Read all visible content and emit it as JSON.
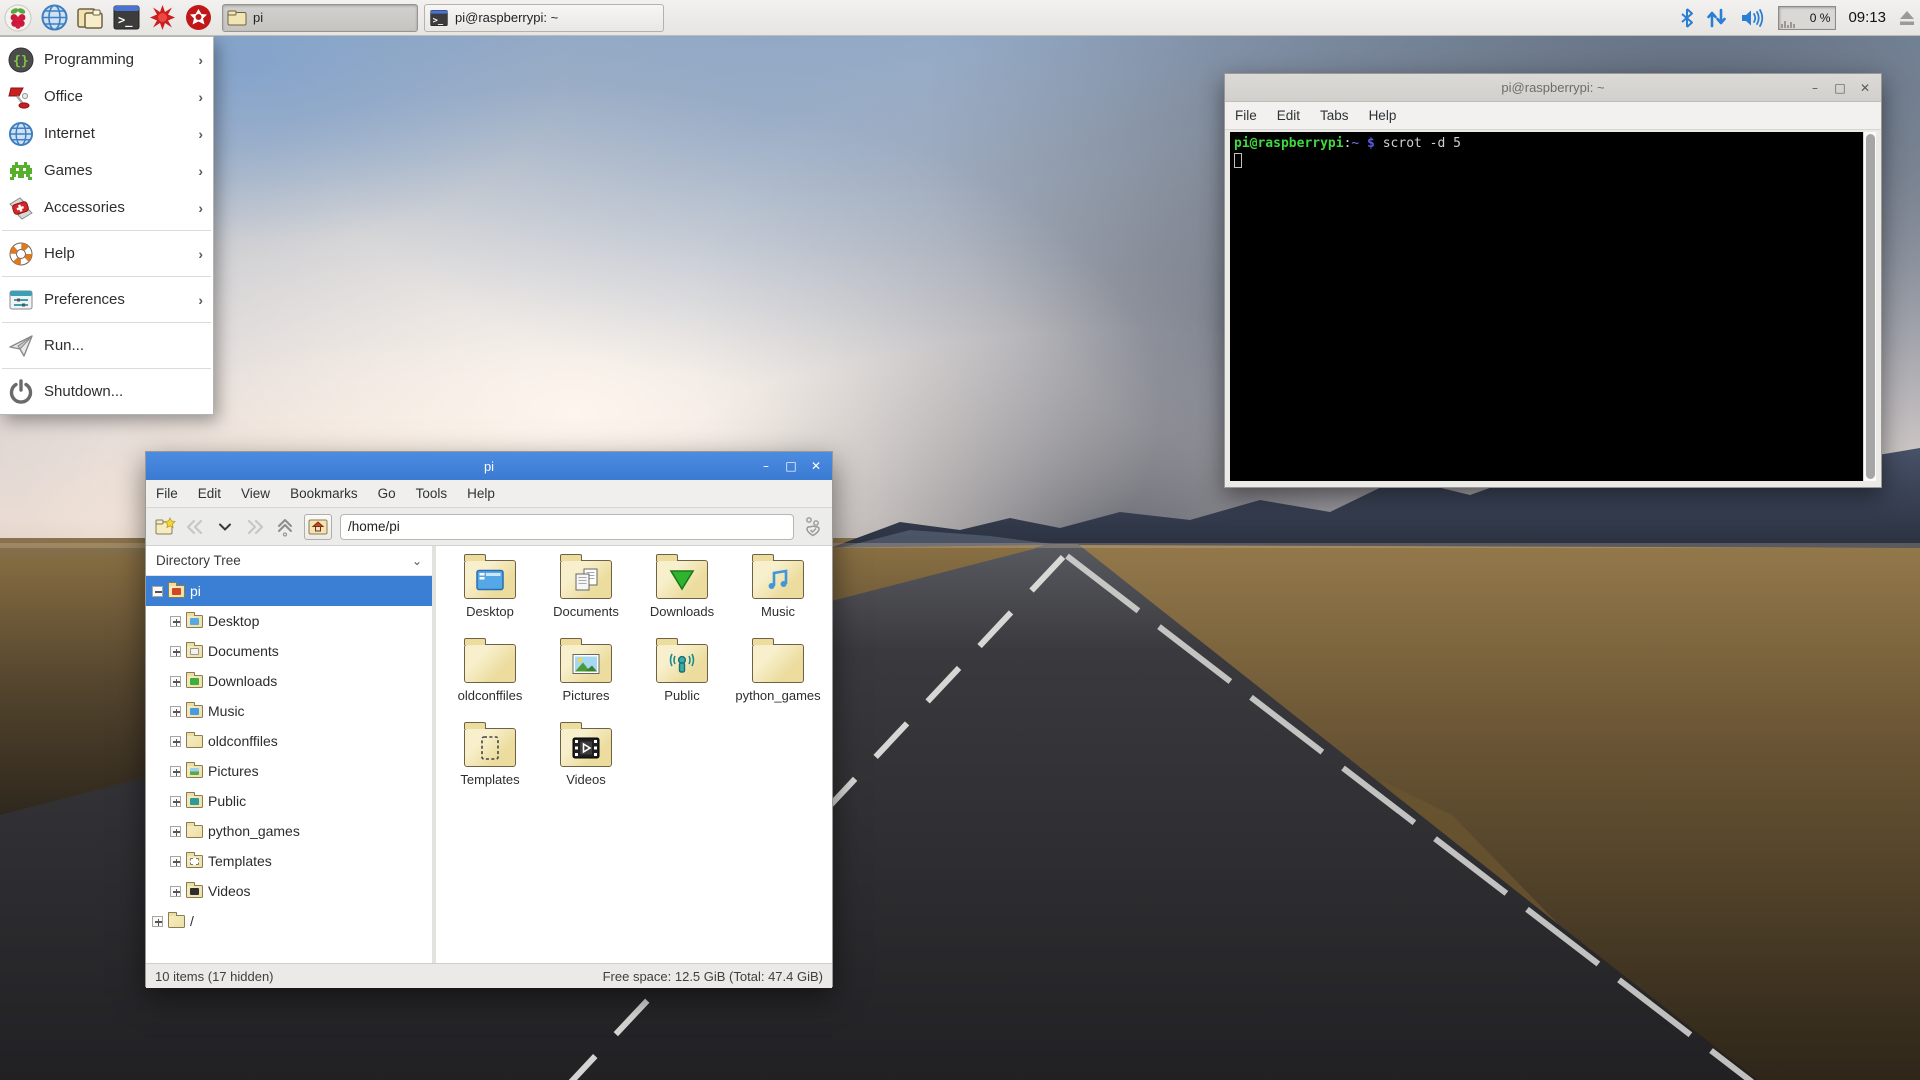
{
  "taskbar": {
    "launchers": [
      {
        "icon": "raspberry-menu-icon"
      },
      {
        "icon": "web-browser-icon"
      },
      {
        "icon": "file-manager-icon"
      },
      {
        "icon": "terminal-icon"
      },
      {
        "icon": "mathematica-icon"
      },
      {
        "icon": "wolfram-icon"
      }
    ],
    "tasks": [
      {
        "label": "pi",
        "icon": "folder-icon",
        "state": "active"
      },
      {
        "label": "pi@raspberrypi: ~",
        "icon": "terminal-icon",
        "state": "normal"
      }
    ],
    "tray": {
      "cpu_value": "0 %",
      "clock": "09:13"
    }
  },
  "start_menu": {
    "items": [
      {
        "label": "Programming",
        "icon": "programming-icon",
        "submenu": true
      },
      {
        "label": "Office",
        "icon": "office-icon",
        "submenu": true
      },
      {
        "label": "Internet",
        "icon": "internet-icon",
        "submenu": true
      },
      {
        "label": "Games",
        "icon": "games-icon",
        "submenu": true
      },
      {
        "label": "Accessories",
        "icon": "accessories-icon",
        "submenu": true
      },
      {
        "label": "Help",
        "icon": "help-icon",
        "submenu": true
      },
      {
        "label": "Preferences",
        "icon": "preferences-icon",
        "submenu": true
      },
      {
        "label": "Run...",
        "icon": "run-icon",
        "submenu": false
      },
      {
        "label": "Shutdown...",
        "icon": "shutdown-icon",
        "submenu": false
      }
    ],
    "submenu_arrow": "›"
  },
  "file_manager": {
    "title": "pi",
    "menubar": [
      "File",
      "Edit",
      "View",
      "Bookmarks",
      "Go",
      "Tools",
      "Help"
    ],
    "path": "/home/pi",
    "tree_header": "Directory Tree",
    "tree": [
      {
        "label": "pi",
        "selected": true,
        "expander": "minus"
      },
      {
        "label": "Desktop"
      },
      {
        "label": "Documents"
      },
      {
        "label": "Downloads"
      },
      {
        "label": "Music"
      },
      {
        "label": "oldconffiles"
      },
      {
        "label": "Pictures"
      },
      {
        "label": "Public"
      },
      {
        "label": "python_games"
      },
      {
        "label": "Templates"
      },
      {
        "label": "Videos"
      },
      {
        "label": "/"
      }
    ],
    "folders": [
      "Desktop",
      "Documents",
      "Downloads",
      "Music",
      "oldconffiles",
      "Pictures",
      "Public",
      "python_games",
      "Templates",
      "Videos"
    ],
    "status_left": "10 items (17 hidden)",
    "status_right": "Free space: 12.5 GiB (Total: 47.4 GiB)"
  },
  "terminal": {
    "title": "pi@raspberrypi: ~",
    "menubar": [
      "File",
      "Edit",
      "Tabs",
      "Help"
    ],
    "prompt_user": "pi@raspberrypi",
    "prompt_colon": ":",
    "prompt_path": "~",
    "prompt_symbol": " $ ",
    "command": "scrot -d 5"
  },
  "window_controls": {
    "minimize": "–",
    "maximize": "□",
    "close": "✕"
  },
  "colors": {
    "titlebar_active": "#3d7fd8",
    "selection_blue": "#3b7fd4",
    "folder_tan": "#ecdd9f",
    "prompt_green": "#3fd83f",
    "prompt_blue": "#6a6ae8",
    "tray_blue": "#2a7fd4"
  }
}
